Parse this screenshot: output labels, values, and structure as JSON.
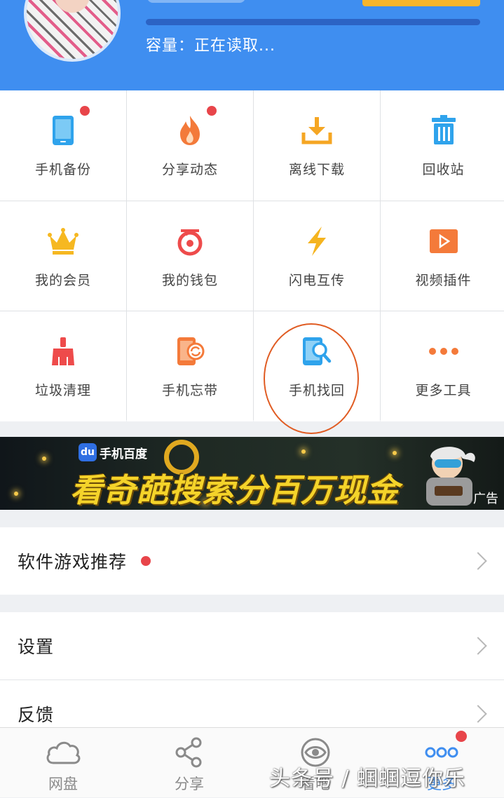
{
  "header": {
    "capacity_text": "容量：正在读取..."
  },
  "grid": {
    "items": [
      {
        "label": "手机备份",
        "icon": "phone-backup-icon",
        "has_dot": true
      },
      {
        "label": "分享动态",
        "icon": "flame-icon",
        "has_dot": true
      },
      {
        "label": "离线下载",
        "icon": "download-icon",
        "has_dot": false
      },
      {
        "label": "回收站",
        "icon": "trash-icon",
        "has_dot": false
      },
      {
        "label": "我的会员",
        "icon": "crown-icon",
        "has_dot": false
      },
      {
        "label": "我的钱包",
        "icon": "wallet-icon",
        "has_dot": false
      },
      {
        "label": "闪电互传",
        "icon": "lightning-icon",
        "has_dot": false
      },
      {
        "label": "视频插件",
        "icon": "video-play-icon",
        "has_dot": false
      },
      {
        "label": "垃圾清理",
        "icon": "broom-icon",
        "has_dot": false
      },
      {
        "label": "手机忘带",
        "icon": "phone-sync-icon",
        "has_dot": false
      },
      {
        "label": "手机找回",
        "icon": "phone-search-icon",
        "has_dot": false
      },
      {
        "label": "更多工具",
        "icon": "more-dots-icon",
        "has_dot": false
      }
    ]
  },
  "banner": {
    "brand": "手机百度",
    "headline": "看奇葩搜索分百万现金",
    "ad_label": "广告"
  },
  "list": {
    "recommend": "软件游戏推荐",
    "settings": "设置",
    "feedback": "反馈"
  },
  "nav": {
    "items": [
      {
        "label": "网盘",
        "icon": "cloud-icon"
      },
      {
        "label": "分享",
        "icon": "share-icon"
      },
      {
        "label": "看吧",
        "icon": "eye-icon"
      },
      {
        "label": "更多",
        "icon": "more-icon"
      }
    ]
  },
  "watermark": "头条号 / 蝈蝈逗你乐",
  "colors": {
    "brand_blue": "#3f8ef0",
    "badge_red": "#e8454a",
    "orange": "#f7b52c",
    "annotation": "#e05c23"
  }
}
